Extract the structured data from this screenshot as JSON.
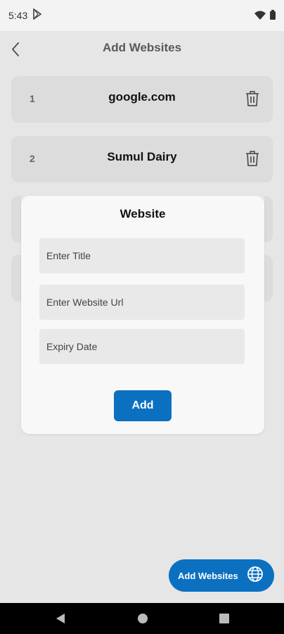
{
  "status": {
    "time": "5:43"
  },
  "app_bar": {
    "title": "Add Websites"
  },
  "websites": [
    {
      "index": "1",
      "name": "google.com"
    },
    {
      "index": "2",
      "name": "Sumul Dairy"
    }
  ],
  "dialog": {
    "title": "Website",
    "title_placeholder": "Enter Title",
    "url_placeholder": "Enter Website Url",
    "expiry_placeholder": "Expiry Date",
    "add_label": "Add"
  },
  "fab": {
    "label": "Add Websites"
  },
  "colors": {
    "accent": "#0c70c0",
    "background": "#e6e6e6",
    "card": "#dcdcdc"
  }
}
